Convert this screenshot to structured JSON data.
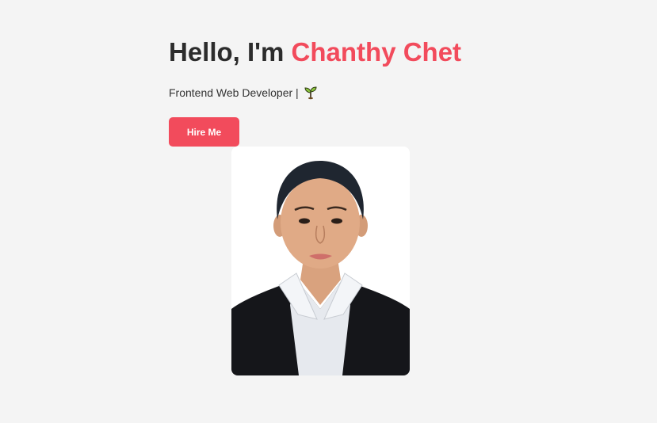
{
  "hero": {
    "greeting": "Hello, I'm ",
    "name": "Chanthy Chet",
    "subtitle": "Frontend Web Developer |",
    "subtitle_icon": "sprout-icon",
    "hire_button_label": "Hire Me"
  },
  "profile_photo": {
    "description_icon": "profile-photo"
  },
  "colors": {
    "accent": "#f24b5c",
    "background": "#f4f4f4",
    "text": "#2c2c2c"
  }
}
